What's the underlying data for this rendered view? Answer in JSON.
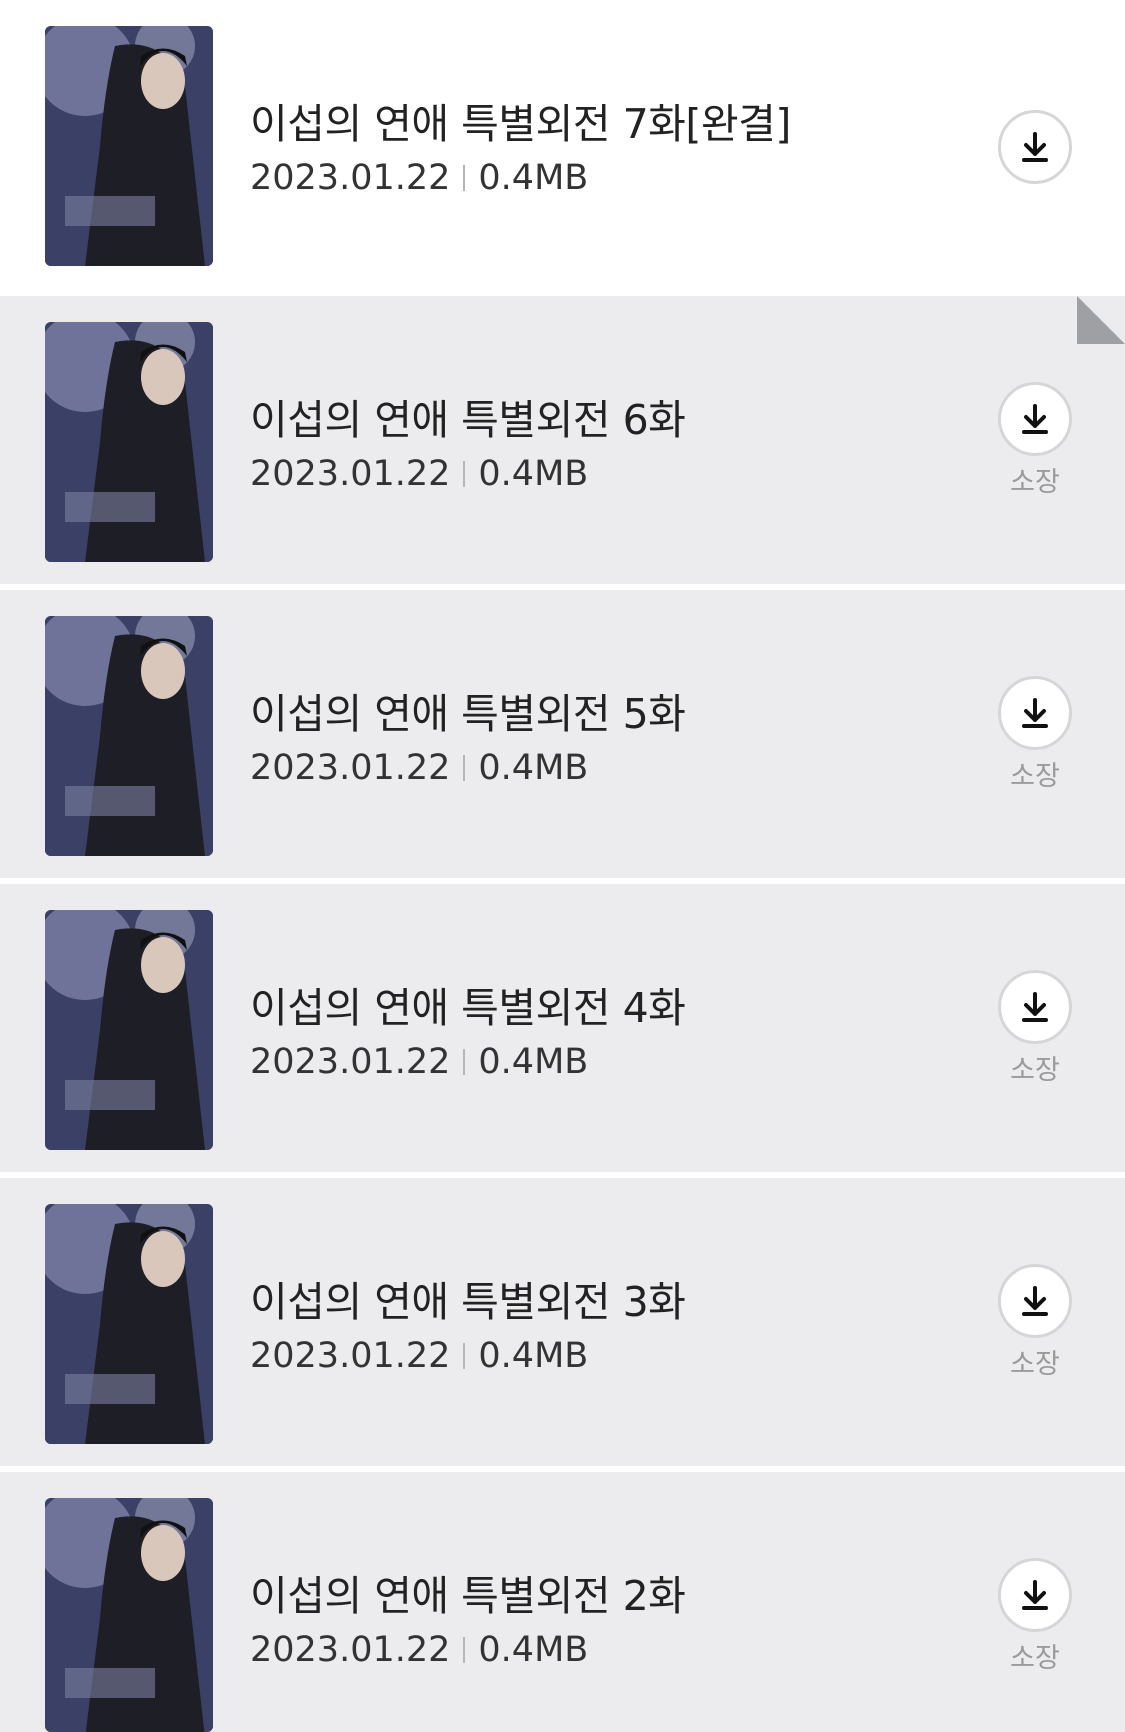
{
  "episodes": [
    {
      "title": "이섭의 연애 특별외전 7화[완결]",
      "date": "2023.01.22",
      "size": "0.4MB",
      "owned_label": "",
      "state": "read"
    },
    {
      "title": "이섭의 연애 특별외전 6화",
      "date": "2023.01.22",
      "size": "0.4MB",
      "owned_label": "소장",
      "state": "unread"
    },
    {
      "title": "이섭의 연애 특별외전 5화",
      "date": "2023.01.22",
      "size": "0.4MB",
      "owned_label": "소장",
      "state": "unread"
    },
    {
      "title": "이섭의 연애 특별외전 4화",
      "date": "2023.01.22",
      "size": "0.4MB",
      "owned_label": "소장",
      "state": "unread"
    },
    {
      "title": "이섭의 연애 특별외전 3화",
      "date": "2023.01.22",
      "size": "0.4MB",
      "owned_label": "소장",
      "state": "unread"
    },
    {
      "title": "이섭의 연애 특별외전 2화",
      "date": "2023.01.22",
      "size": "0.4MB",
      "owned_label": "소장",
      "state": "unread"
    }
  ],
  "icons": {
    "download": "download-icon",
    "cover": "cover-thumbnail"
  },
  "colors": {
    "unread_row_bg": "#ececee",
    "read_row_bg": "#ffffff",
    "meta_separator": "#b5b5b5"
  }
}
